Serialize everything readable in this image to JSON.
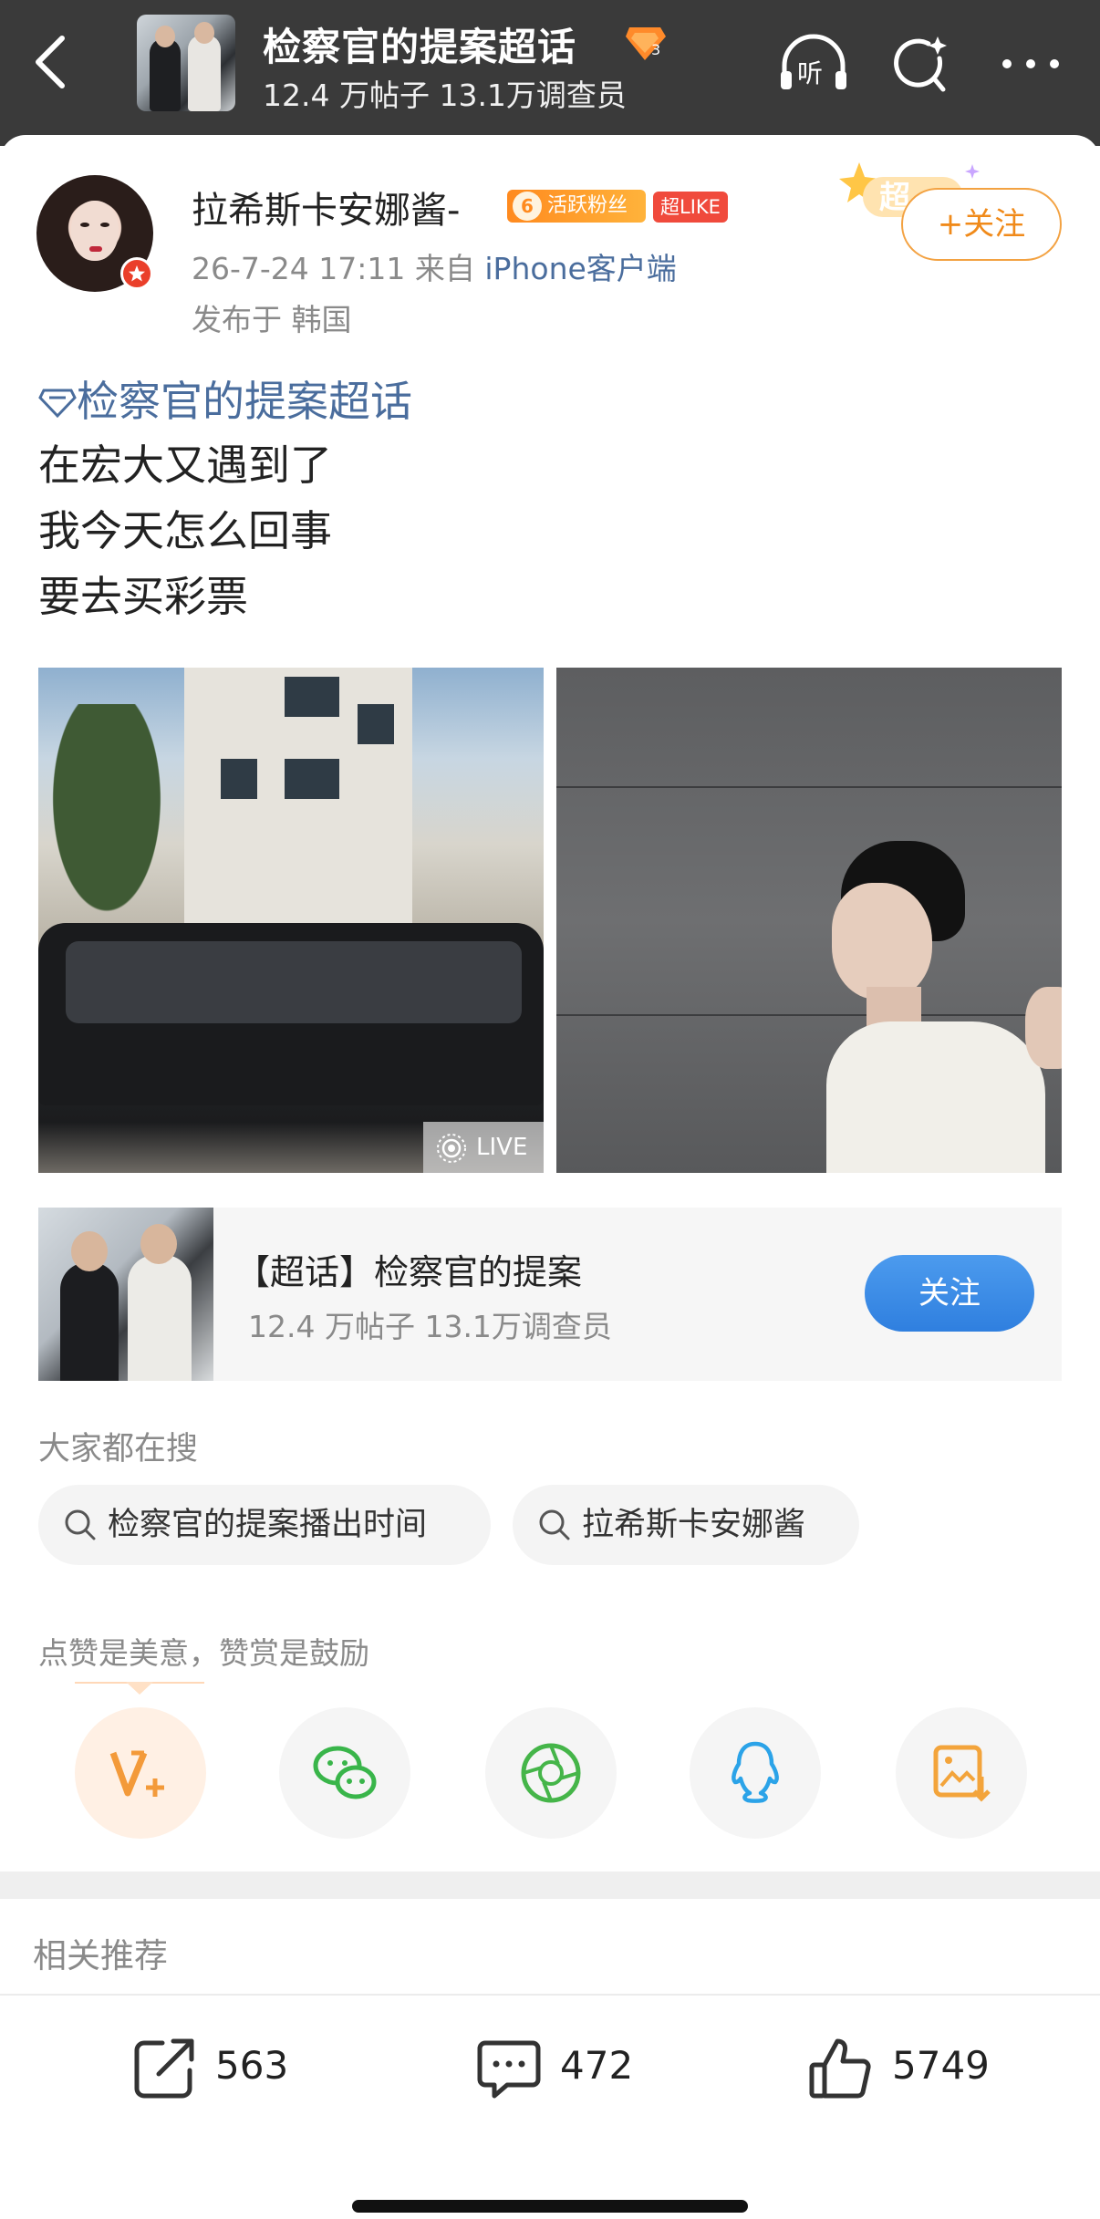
{
  "header": {
    "title": "检察官的提案超话",
    "level_badge": "3",
    "subtitle": "12.4 万帖子 13.1万调查员",
    "listen_label": "听"
  },
  "post": {
    "username": "拉希斯卡安娜酱-",
    "fan_level": "6",
    "fan_badge_label": "活跃粉丝",
    "like_badge_label": "超LIKE",
    "timestamp": "26-7-24 17:11",
    "source_prefix": "来自",
    "source_client": "iPhone客户端",
    "location": "发布于 韩国",
    "super_deco_label": "超",
    "follow_label": "+关注",
    "topic_tag": "检察官的提案超话",
    "lines": [
      "在宏大又遇到了",
      "我今天怎么回事",
      "要去买彩票"
    ],
    "live_label": "LIVE"
  },
  "topic_card": {
    "title": "【超话】检察官的提案",
    "stats": "12.4 万帖子 13.1万调查员",
    "follow_label": "关注"
  },
  "searching": {
    "title": "大家都在搜",
    "chips": [
      "检察官的提案播出时间",
      "拉希斯卡安娜酱"
    ]
  },
  "share": {
    "tip": "点赞是美意，赞赏是鼓励",
    "items": [
      "reward-icon",
      "wechat-icon",
      "moments-icon",
      "qq-icon",
      "save-image-icon"
    ]
  },
  "related": {
    "title": "相关推荐"
  },
  "actions": {
    "repost_count": "563",
    "comment_count": "472",
    "like_count": "5749"
  },
  "colors": {
    "header_bg": "#3a3a3a",
    "link_blue": "#4a6d9d",
    "accent_orange": "#f08a1a",
    "follow_blue": "#2f7fdf"
  }
}
